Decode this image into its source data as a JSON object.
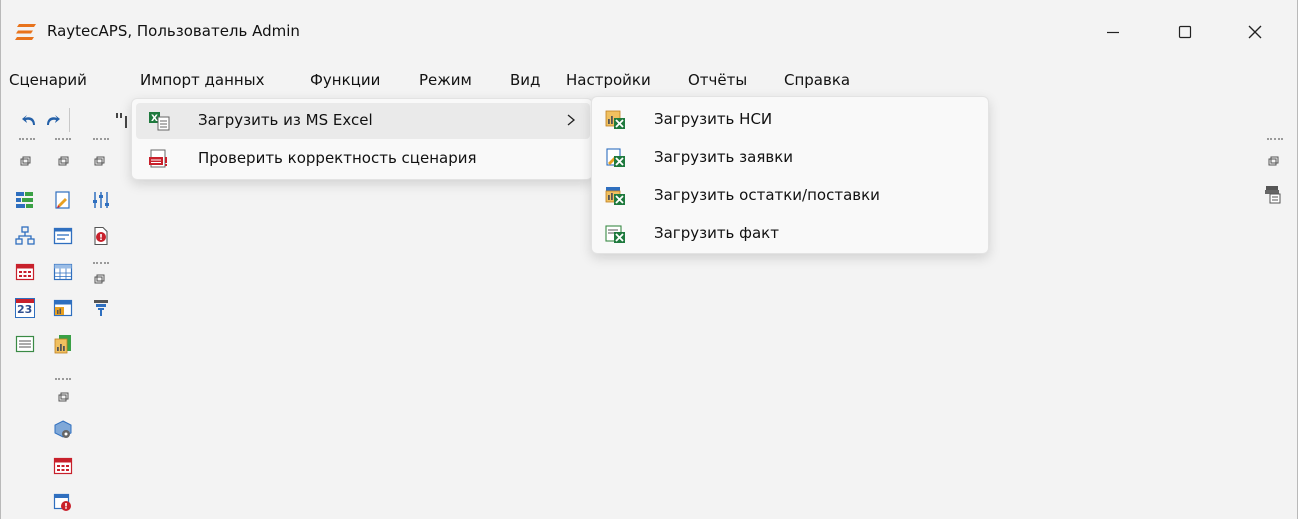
{
  "window": {
    "title": "RaytecAPS, Пользователь Admin",
    "accent_color": "#e8731c"
  },
  "menubar": {
    "items": [
      {
        "label": "Сценарий"
      },
      {
        "label": "Импорт данных"
      },
      {
        "label": "Функции"
      },
      {
        "label": "Режим"
      },
      {
        "label": "Вид"
      },
      {
        "label": "Настройки"
      },
      {
        "label": "Отчёты"
      },
      {
        "label": "Справка"
      }
    ]
  },
  "dropdown": {
    "items": [
      {
        "label": "Загрузить из MS Excel",
        "icon": "excel-import-icon",
        "has_submenu": true,
        "highlighted": true
      },
      {
        "label": "Проверить корректность сценария",
        "icon": "check-scenario-icon",
        "has_submenu": false
      }
    ]
  },
  "submenu": {
    "items": [
      {
        "label": "Загрузить НСИ",
        "icon": "excel-load-reference-icon"
      },
      {
        "label": "Загрузить заявки",
        "icon": "excel-load-orders-icon"
      },
      {
        "label": "Загрузить остатки/поставки",
        "icon": "excel-load-stock-icon"
      },
      {
        "label": "Загрузить факт",
        "icon": "excel-load-fact-icon"
      }
    ]
  },
  "toolbar": {
    "calendar_day": "23"
  }
}
